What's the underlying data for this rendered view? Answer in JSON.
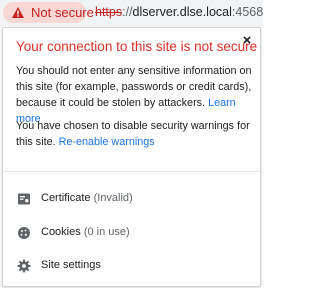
{
  "omnibox": {
    "security_chip_label": "Not secure",
    "url_scheme": "https",
    "url_rest_sep": "://",
    "url_host": "dlserver.dlse.local",
    "url_port": ":4568"
  },
  "bubble": {
    "title": "Your connection to this site is not secure",
    "close_glyph": "×",
    "paragraph1_text": "You should not enter any sensitive information on this site (for example, passwords or credit cards), because it could be stolen by attackers.",
    "paragraph1_link": "Learn more",
    "paragraph2_text": "You have chosen to disable security warnings for this site.",
    "paragraph2_link": "Re-enable warnings",
    "items": [
      {
        "label": "Certificate",
        "sub": "(Invalid)",
        "icon": "certificate-icon"
      },
      {
        "label": "Cookies",
        "sub": "(0 in use)",
        "icon": "cookie-icon"
      },
      {
        "label": "Site settings",
        "sub": "",
        "icon": "gear-icon"
      }
    ]
  },
  "colors": {
    "danger_red": "#d93025",
    "chip_bg": "#f8d7d5",
    "link_blue": "#1a73e8"
  }
}
